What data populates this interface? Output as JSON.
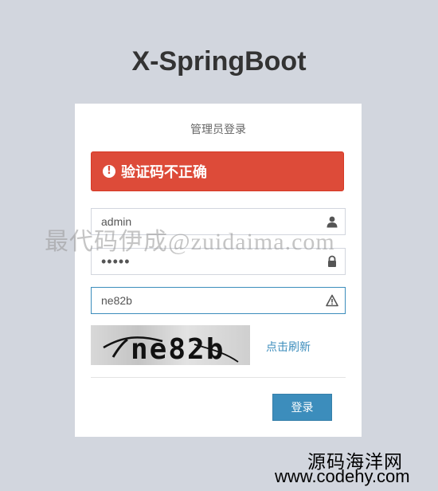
{
  "app": {
    "title": "X-SpringBoot"
  },
  "login": {
    "subtitle": "管理员登录",
    "error_message": "验证码不正确",
    "username": {
      "value": "admin"
    },
    "password": {
      "value": "•••••"
    },
    "captcha": {
      "value": "ne82b",
      "image_text": "ne82b",
      "refresh_label": "点击刷新"
    },
    "submit_label": "登录"
  },
  "watermark": {
    "text": "最代码伊成@zuidaima.com"
  },
  "site_badge": {
    "cn": "源码海洋网",
    "url": "www.codehy.com"
  },
  "colors": {
    "background": "#d2d6de",
    "error": "#dd4b39",
    "primary": "#3c8dbc"
  }
}
